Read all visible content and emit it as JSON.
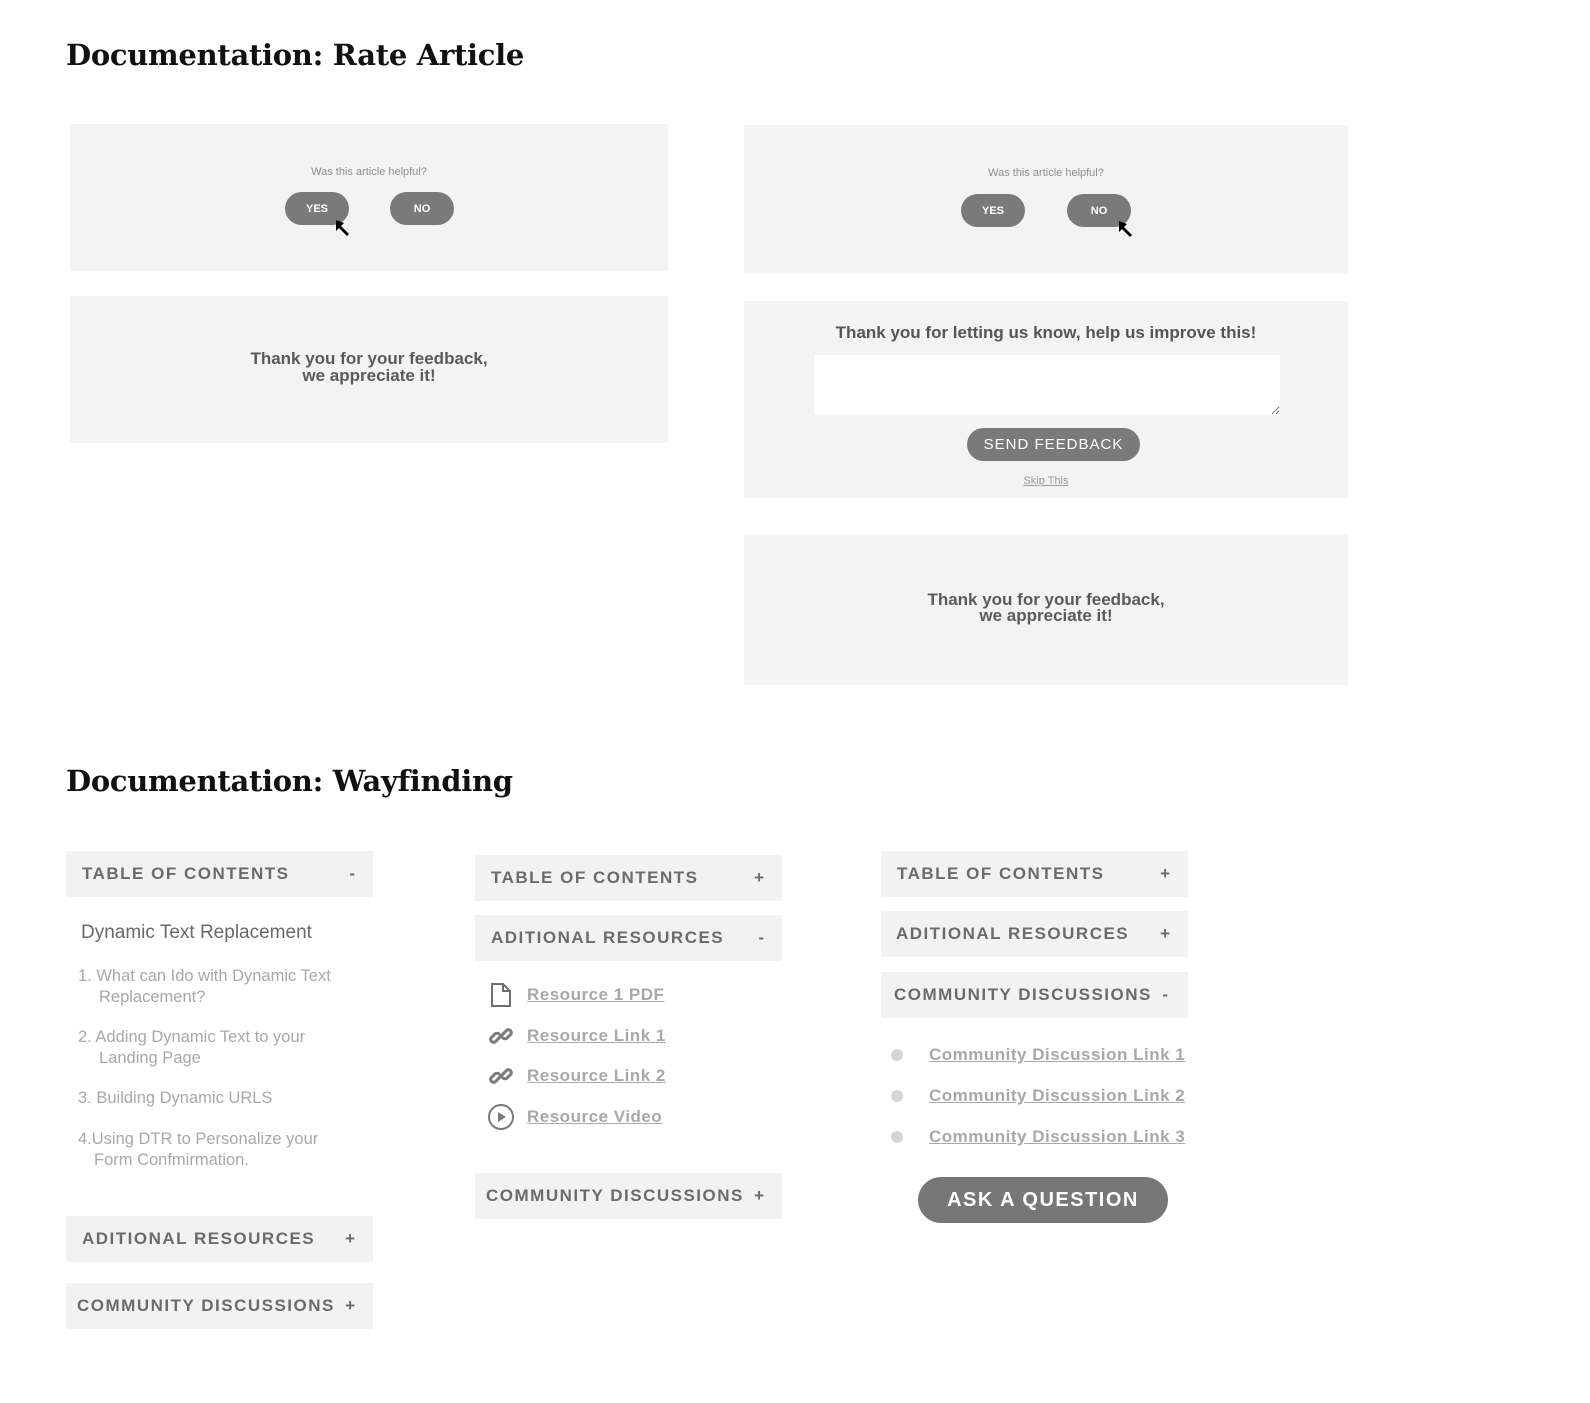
{
  "sections": {
    "rate_article_title": "Documentation: Rate Article",
    "wayfinding_title": "Documentation: Wayfinding"
  },
  "rate_article": {
    "question": "Was this article helpful?",
    "yes_label": "YES",
    "no_label": "NO",
    "thanks_line1": "Thank you for your feedback,",
    "thanks_line2": "we appreciate it!",
    "improve_prompt": "Thank you for letting us know, help us improve this!",
    "feedback_placeholder": "",
    "feedback_value": "",
    "send_feedback_label": "SEND FEEDBACK",
    "skip_label": "Skip This"
  },
  "wayfinding": {
    "toc_label": "TABLE OF CONTENTS",
    "resources_label": "ADITIONAL RESOURCES",
    "community_label": "COMMUNITY DISCUSSIONS",
    "expanded_sign": "-",
    "collapsed_sign": "+",
    "toc": {
      "title": "Dynamic Text Replacement",
      "items": [
        {
          "line1": "1. What can Ido with Dynamic Text",
          "line2": "Replacement?"
        },
        {
          "line1": "2. Adding Dynamic Text to your",
          "line2": "Landing Page"
        },
        {
          "line1": "3. Building Dynamic URLS",
          "line2": ""
        },
        {
          "line1": "4.Using DTR to Personalize your",
          "line2": "Form Confmirmation."
        }
      ]
    },
    "resources": [
      {
        "icon": "document-icon",
        "label": "Resource 1 PDF"
      },
      {
        "icon": "link-icon",
        "label": "Resource Link 1"
      },
      {
        "icon": "link-icon",
        "label": "Resource Link 2"
      },
      {
        "icon": "play-circle-icon",
        "label": "Resource Video"
      }
    ],
    "community": [
      {
        "label": "Community Discussion Link 1"
      },
      {
        "label": "Community Discussion Link 2"
      },
      {
        "label": "Community Discussion Link 3"
      }
    ],
    "ask_label": "ASK A QUESTION"
  },
  "colors": {
    "panel_bg": "#f3f3f3",
    "button_bg": "#7a7a7a",
    "heading": "#111111",
    "muted_text": "#a8a8a8"
  }
}
